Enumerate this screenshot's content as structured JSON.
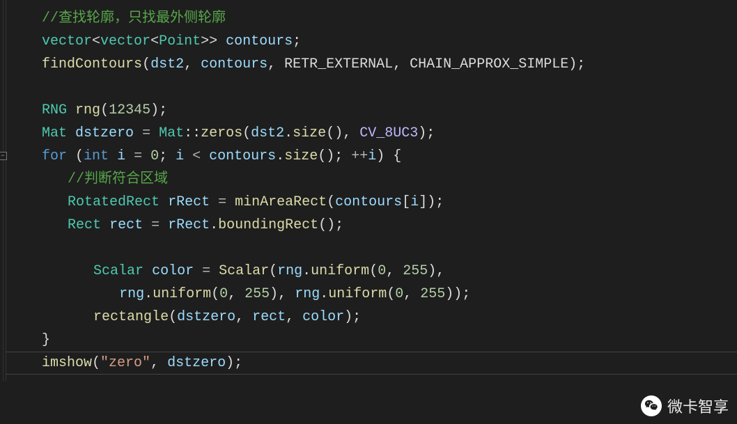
{
  "code": {
    "l1": "//查找轮廓，只找最外侧轮廓",
    "l2a": "vector",
    "l2b": "vector",
    "l2c": "Point",
    "l2d": "contours",
    "l3a": "findContours",
    "l3b": "dst2",
    "l3c": "contours",
    "l3d": "RETR_EXTERNAL",
    "l3e": "CHAIN_APPROX_SIMPLE",
    "l5a": "RNG",
    "l5b": "rng",
    "l5c": "12345",
    "l6a": "Mat",
    "l6b": "dstzero",
    "l6c": "Mat",
    "l6d": "zeros",
    "l6e": "dst2",
    "l6f": "size",
    "l6g": "CV_8UC3",
    "l7a": "for",
    "l7b": "int",
    "l7c": "i",
    "l7d": "0",
    "l7e": "i",
    "l7f": "contours",
    "l7g": "size",
    "l7h": "i",
    "l8": "//判断符合区域",
    "l9a": "RotatedRect",
    "l9b": "rRect",
    "l9c": "minAreaRect",
    "l9d": "contours",
    "l9e": "i",
    "l10a": "Rect",
    "l10b": "rect",
    "l10c": "rRect",
    "l10d": "boundingRect",
    "l12a": "Scalar",
    "l12b": "color",
    "l12c": "Scalar",
    "l12d": "rng",
    "l12e": "uniform",
    "l12f": "0",
    "l12g": "255",
    "l13a": "rng",
    "l13b": "uniform",
    "l13c": "0",
    "l13d": "255",
    "l13e": "rng",
    "l13f": "uniform",
    "l13g": "0",
    "l13h": "255",
    "l14a": "rectangle",
    "l14b": "dstzero",
    "l14c": "rect",
    "l14d": "color",
    "l16a": "imshow",
    "l16b": "\"zero\"",
    "l16c": "dstzero"
  },
  "watermark": "微卡智享"
}
